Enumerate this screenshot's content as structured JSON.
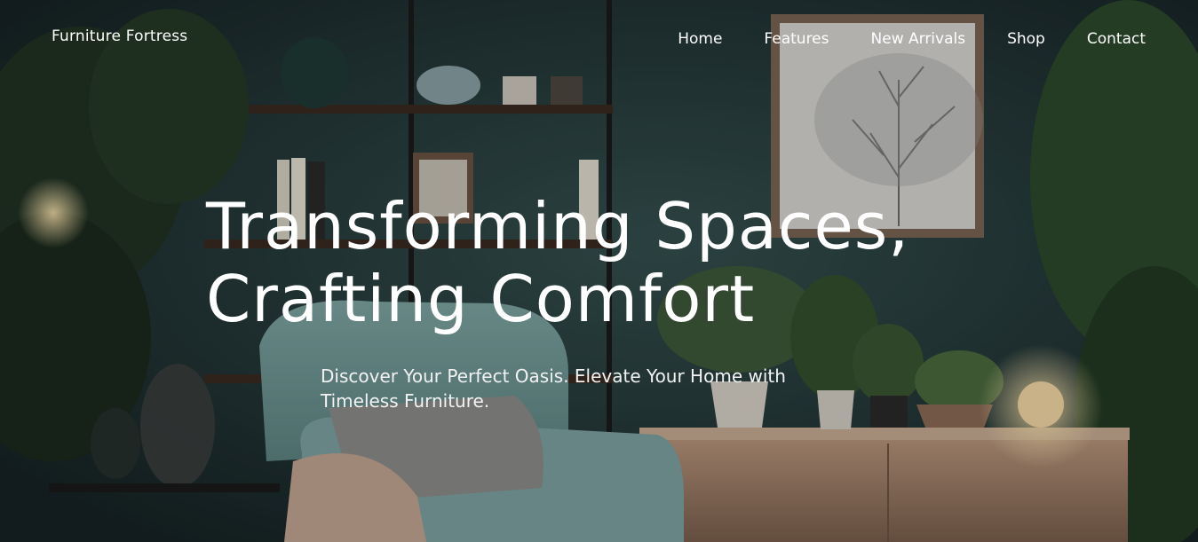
{
  "brand": {
    "name": "Furniture Fortress"
  },
  "nav": {
    "items": [
      "Home",
      "Features",
      "New Arrivals",
      "Shop",
      "Contact"
    ]
  },
  "hero": {
    "headline_line1": "Transforming Spaces,",
    "headline_line2": "Crafting Comfort",
    "subtitle": "Discover Your Perfect Oasis. Elevate Your Home with Timeless Furniture."
  },
  "colors": {
    "wall": "#2a3d40",
    "text": "#ffffff",
    "armchair": "#8fb3b0",
    "sideboard": "#a78a74"
  },
  "background_image": {
    "scene": "dark teal living room with plants, shelves, framed tree print, armchair and sideboard"
  }
}
